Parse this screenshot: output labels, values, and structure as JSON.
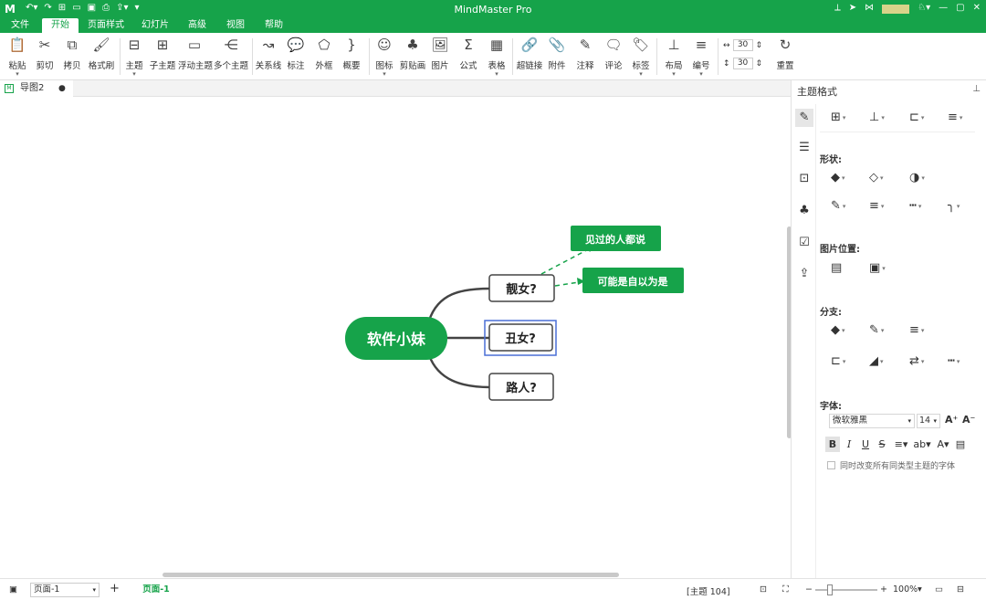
{
  "app": {
    "title": "MindMaster Pro",
    "logo": "M"
  },
  "colors": {
    "brand": "#16a34a",
    "selection": "#4a6fd6"
  },
  "menu": {
    "tabs": [
      {
        "label": "文件",
        "active": false
      },
      {
        "label": "开始",
        "active": true
      },
      {
        "label": "页面样式",
        "active": false
      },
      {
        "label": "幻灯片",
        "active": false
      },
      {
        "label": "高级",
        "active": false
      },
      {
        "label": "视图",
        "active": false
      },
      {
        "label": "帮助",
        "active": false
      }
    ]
  },
  "ribbon": {
    "buttons": [
      {
        "label": "粘贴",
        "icon": "paste-icon",
        "glyph": "📋"
      },
      {
        "label": "剪切",
        "icon": "cut-icon",
        "glyph": "✂"
      },
      {
        "label": "拷贝",
        "icon": "copy-icon",
        "glyph": "⧉"
      },
      {
        "label": "格式刷",
        "icon": "format-painter-icon",
        "glyph": "🖌"
      },
      {
        "label": "主题",
        "icon": "topic-icon",
        "glyph": "⊟"
      },
      {
        "label": "子主题",
        "icon": "subtopic-icon",
        "glyph": "⊞"
      },
      {
        "label": "浮动主题",
        "icon": "floating-topic-icon",
        "glyph": "▭"
      },
      {
        "label": "多个主题",
        "icon": "multiple-topics-icon",
        "glyph": "⋲"
      },
      {
        "label": "关系线",
        "icon": "relationship-icon",
        "glyph": "↝"
      },
      {
        "label": "标注",
        "icon": "callout-icon",
        "glyph": "💬"
      },
      {
        "label": "外框",
        "icon": "boundary-icon",
        "glyph": "⬠"
      },
      {
        "label": "概要",
        "icon": "summary-icon",
        "glyph": "}"
      },
      {
        "label": "图标",
        "icon": "icon-picker-icon",
        "glyph": "☺"
      },
      {
        "label": "剪贴画",
        "icon": "clipart-icon",
        "glyph": "♣"
      },
      {
        "label": "图片",
        "icon": "image-icon",
        "glyph": "🖼"
      },
      {
        "label": "公式",
        "icon": "formula-icon",
        "glyph": "Σ"
      },
      {
        "label": "表格",
        "icon": "table-icon",
        "glyph": "▦"
      },
      {
        "label": "超链接",
        "icon": "hyperlink-icon",
        "glyph": "🔗"
      },
      {
        "label": "附件",
        "icon": "attachment-icon",
        "glyph": "📎"
      },
      {
        "label": "注释",
        "icon": "note-icon",
        "glyph": "✎"
      },
      {
        "label": "评论",
        "icon": "comment-icon",
        "glyph": "🗨"
      },
      {
        "label": "标签",
        "icon": "tag-icon",
        "glyph": "🏷"
      },
      {
        "label": "布局",
        "icon": "layout-icon",
        "glyph": "⊥"
      },
      {
        "label": "编号",
        "icon": "numbering-icon",
        "glyph": "≡"
      },
      {
        "label": "重置",
        "icon": "reset-icon",
        "glyph": "↻"
      }
    ],
    "spacing_h": "30",
    "spacing_v": "30"
  },
  "doc": {
    "tab_label": "导图2"
  },
  "mindmap": {
    "central": "软件小妹",
    "topics": [
      "靓女?",
      "丑女?",
      "路人?"
    ],
    "floating": [
      "见过的人都说",
      "可能是自以为是"
    ]
  },
  "panel": {
    "title": "主题格式",
    "shape_label": "形状:",
    "image_pos_label": "图片位置:",
    "branch_label": "分支:",
    "font_label": "字体:",
    "font_name": "微软雅黑",
    "font_size": "14",
    "same_type_label": "同时改变所有同类型主题的字体"
  },
  "status": {
    "page_select": "页面-1",
    "active_page": "页面-1",
    "topic_count": "[主题 104]",
    "zoom": "100%"
  }
}
